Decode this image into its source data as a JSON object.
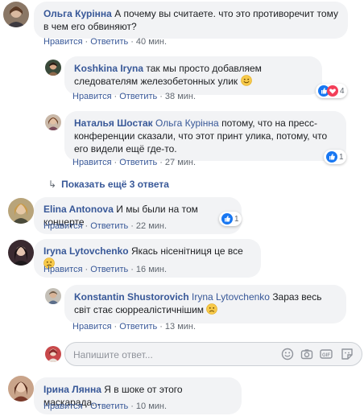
{
  "comments": [
    {
      "author": "Ольга Курінна",
      "text": "А почему вы считаете. что это противоречит тому в чем его обвиняют?",
      "like": "Нравится",
      "reply": "Ответить",
      "time": "40 мин."
    },
    {
      "author": "Koshkina Iryna",
      "text": "так мы просто добавляем следователям железобетонных улик",
      "emoji": "smile-emoji",
      "like": "Нравится",
      "reply": "Ответить",
      "time": "38 мин.",
      "reactions": {
        "icons": [
          "like-reaction",
          "love-reaction"
        ],
        "count": "4"
      }
    },
    {
      "author": "Наталья Шостак",
      "mention": "Ольга Курінна",
      "text": "потому, что на пресс-конференции сказали, что этот принт улика, потому, что его видели ещё где-то.",
      "like": "Нравится",
      "reply": "Ответить",
      "time": "27 мин.",
      "reactions": {
        "icons": [
          "like-reaction"
        ],
        "count": "1"
      }
    },
    {
      "author": "Elina Antonova",
      "text": "И мы были на том концерте",
      "like": "Нравится",
      "reply": "Ответить",
      "time": "22 мин.",
      "reactions": {
        "icons": [
          "like-reaction"
        ],
        "count": "1"
      }
    },
    {
      "author": "Iryna Lytovchenko",
      "text": "Якась нісенітниця це все",
      "emoji": "sad-emoji",
      "like": "Нравится",
      "reply": "Ответить",
      "time": "16 мин."
    },
    {
      "author": "Konstantin Shustorovich",
      "mention": "Iryna Lytovchenko",
      "text": "Зараз весь світ стає сюрреалістичнішим",
      "emoji": "sad-emoji",
      "like": "Нравится",
      "reply": "Ответить",
      "time": "13 мин."
    },
    {
      "author": "Ірина Лянна",
      "text": "Я в шоке от этого маскарада...",
      "like": "Нравится",
      "reply": "Ответить",
      "time": "10 мин."
    }
  ],
  "more_replies": {
    "label": "Показать ещё 3 ответа"
  },
  "reply_box": {
    "placeholder": "Напишите ответ...",
    "tools": [
      "emoji-icon",
      "camera-icon",
      "gif-icon",
      "sticker-icon"
    ]
  },
  "colors": {
    "link": "#385898",
    "bubble": "#f2f3f5",
    "meta": "#606770",
    "like_blue": "#1877f2",
    "love_red": "#f33e58",
    "emoji_yellow": "#f7c94a"
  }
}
